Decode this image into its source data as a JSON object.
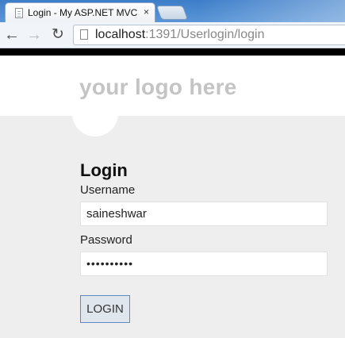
{
  "browser": {
    "tab_title": "Login - My ASP.NET MVC",
    "tab_close": "×",
    "back": "←",
    "forward": "→",
    "reload": "↻",
    "url_host": "localhost",
    "url_rest": ":1391/Userlogin/login"
  },
  "page": {
    "logo_text": "your logo here",
    "form": {
      "title": "Login",
      "username_label": "Username",
      "username_value": "saineshwar",
      "password_label": "Password",
      "password_mask": "••••••••••",
      "submit_label": "LOGIN"
    }
  },
  "colors": {
    "tabstrip": "#3d7ec9",
    "content_bg": "#efeeef",
    "logo": "#c4c4c4",
    "button_border": "#5f8bc0"
  }
}
